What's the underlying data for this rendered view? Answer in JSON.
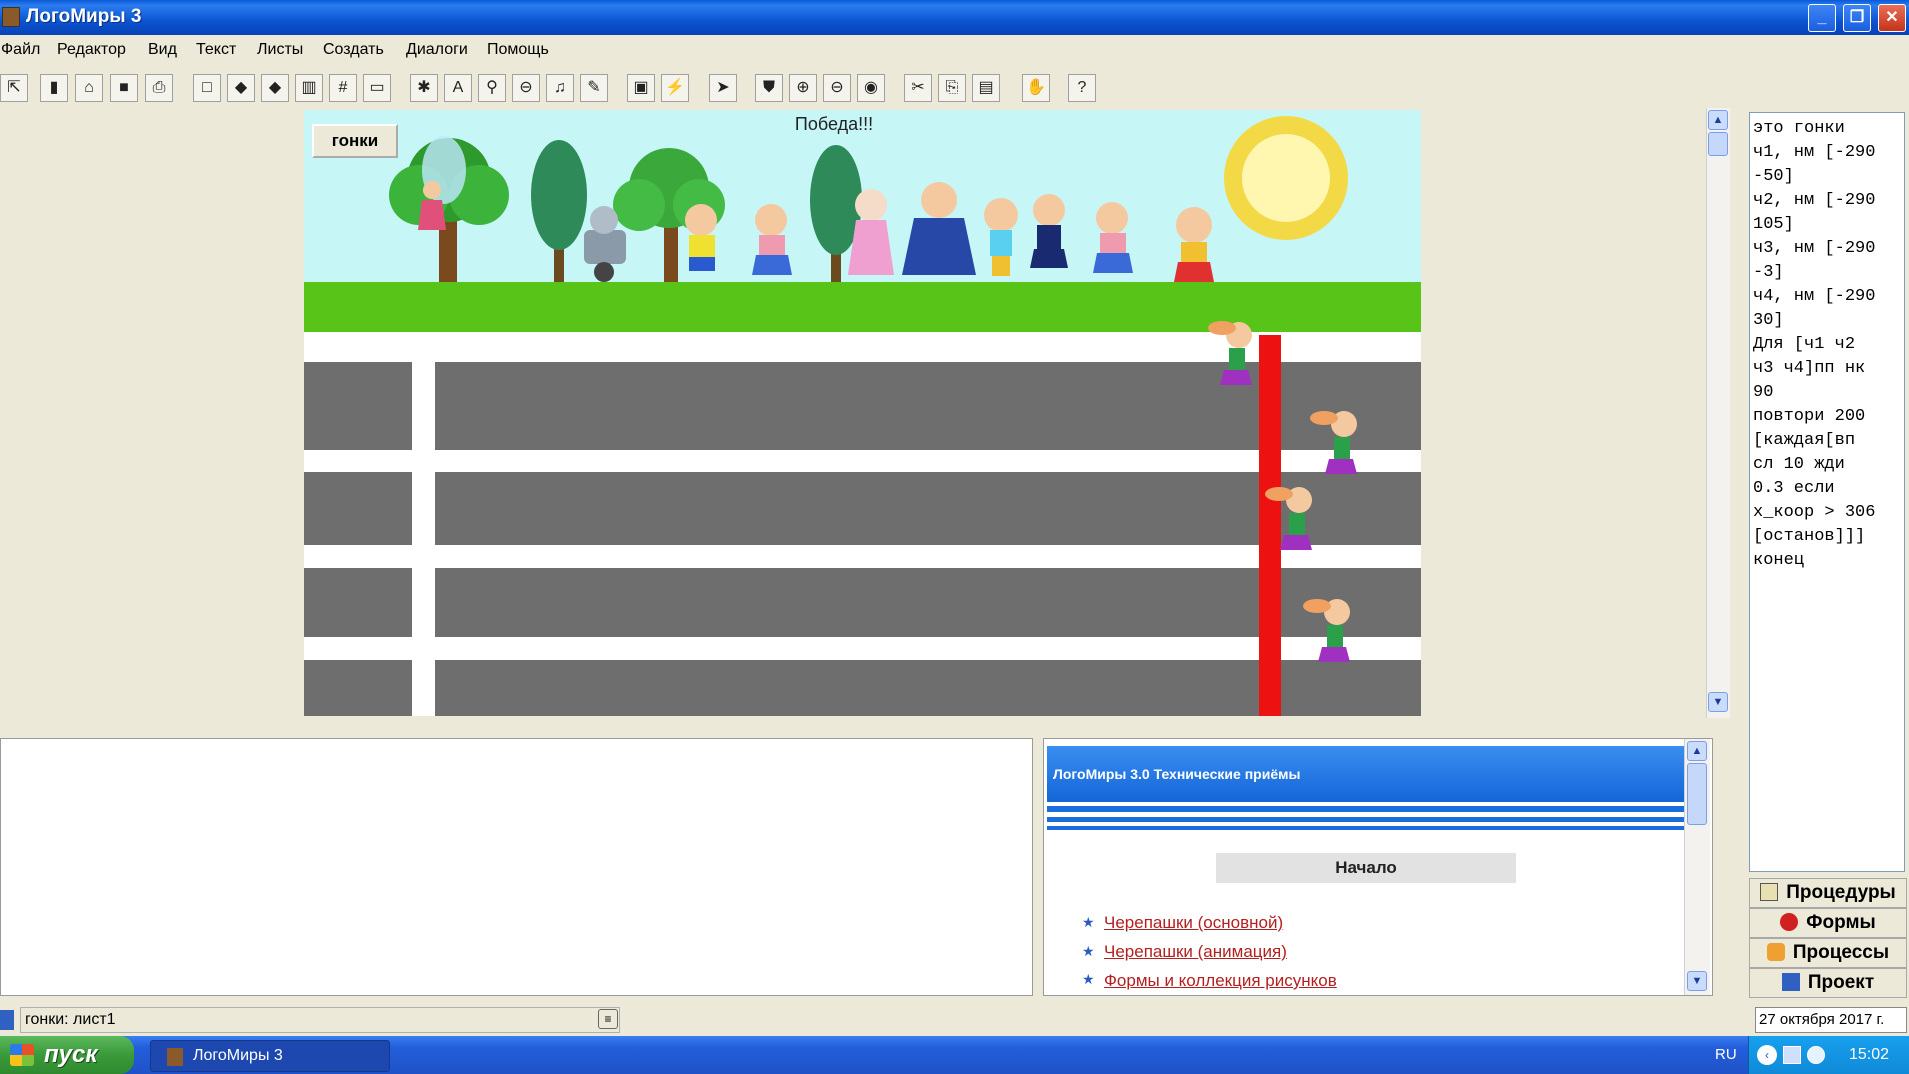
{
  "window": {
    "title": "ЛогоМиры 3"
  },
  "menu": [
    "Файл",
    "Редактор",
    "Вид",
    "Текст",
    "Листы",
    "Создать",
    "Диалоги",
    "Помощь"
  ],
  "stage": {
    "title": "Победа!!!",
    "button_label": "гонки"
  },
  "procedures": {
    "code_lines": [
      "это гонки",
      "ч1, нм [-290",
      "-50]",
      "ч2, нм [-290",
      "105]",
      "ч3, нм [-290",
      "-3]",
      "ч4, нм [-290",
      "30]",
      "Для [ч1 ч2",
      "ч3 ч4]пп нк",
      "90",
      "повтори 200",
      "[каждая[вп",
      "сл 10 жди",
      "0.3 если",
      "x_коор > 306",
      "[останов]]]",
      "конец"
    ],
    "tabs": [
      "Процедуры",
      "Формы",
      "Процессы",
      "Проект"
    ]
  },
  "help": {
    "banner": "ЛогоМиры 3.0 Технические приёмы",
    "start": "Начало",
    "links": [
      "Черепашки (основной)",
      "Черепашки (анимация)",
      "Формы и коллекция рисунков"
    ]
  },
  "status": {
    "page": "гонки: лист1",
    "date": "27 октября 2017 г."
  },
  "taskbar": {
    "start_label": "пуск",
    "task_label": "ЛогоМиры 3",
    "lang": "RU",
    "clock": "15:02"
  },
  "colors": {
    "finish_line": "#ee1111",
    "grass": "#58c418",
    "sky": "#c6f6f6",
    "road": "#6e6e6e"
  }
}
